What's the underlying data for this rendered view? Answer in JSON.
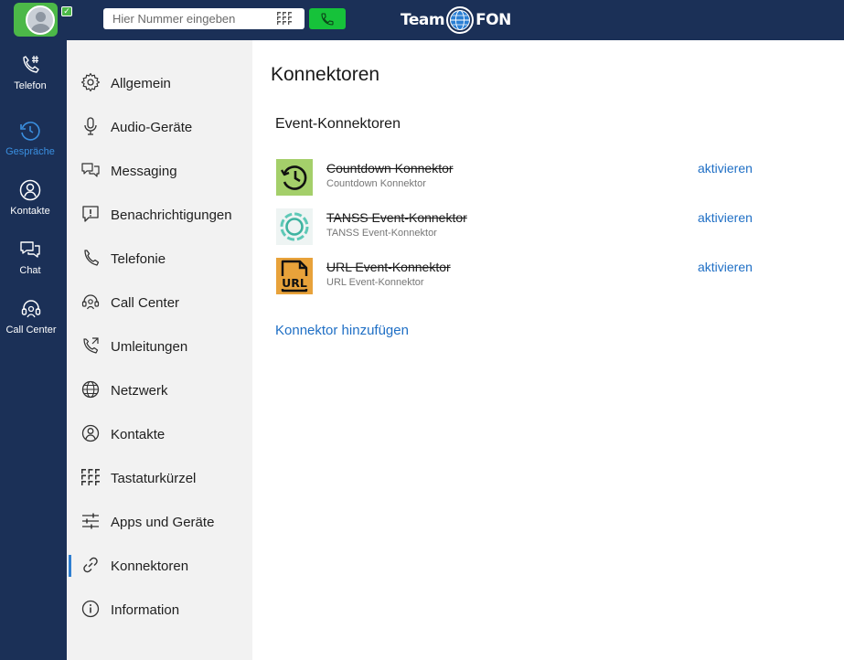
{
  "topbar": {
    "dial_placeholder": "Hier Nummer eingeben",
    "logo_left": "Team",
    "logo_right": "FON",
    "accent": "#1b3057",
    "call_color": "#16c23a"
  },
  "nav": {
    "items": [
      {
        "label": "Telefon",
        "icon": "phone-hash-icon"
      },
      {
        "label": "Gespräche",
        "icon": "history-icon",
        "active": true
      },
      {
        "label": "Kontakte",
        "icon": "contact-icon"
      },
      {
        "label": "Chat",
        "icon": "chat-icon"
      },
      {
        "label": "Call Center",
        "icon": "headset-icon"
      }
    ]
  },
  "settings": {
    "items": [
      {
        "label": "Allgemein",
        "icon": "gear-icon"
      },
      {
        "label": "Audio-Geräte",
        "icon": "microphone-icon"
      },
      {
        "label": "Messaging",
        "icon": "messaging-icon"
      },
      {
        "label": "Benachrichtigungen",
        "icon": "notification-icon"
      },
      {
        "label": "Telefonie",
        "icon": "phone-icon"
      },
      {
        "label": "Call Center",
        "icon": "headset-icon"
      },
      {
        "label": "Umleitungen",
        "icon": "forward-icon"
      },
      {
        "label": "Netzwerk",
        "icon": "globe-icon"
      },
      {
        "label": "Kontakte",
        "icon": "contact-icon"
      },
      {
        "label": "Tastaturkürzel",
        "icon": "keypad-icon"
      },
      {
        "label": "Apps und Geräte",
        "icon": "sliders-icon"
      },
      {
        "label": "Konnektoren",
        "icon": "link-icon",
        "selected": true
      },
      {
        "label": "Information",
        "icon": "info-icon"
      }
    ]
  },
  "main": {
    "title": "Konnektoren",
    "section_title": "Event-Konnektoren",
    "connectors": [
      {
        "name": "Countdown Konnektor",
        "subtitle": "Countdown Konnektor",
        "action": "aktivieren",
        "icon": "countdown-icon",
        "icon_bg": "#a4cf6a"
      },
      {
        "name": "TANSS Event-Konnektor",
        "subtitle": "TANSS Event-Konnektor",
        "action": "aktivieren",
        "icon": "tanss-icon",
        "icon_bg": "#eef4f3"
      },
      {
        "name": "URL Event-Konnektor",
        "subtitle": "URL Event-Konnektor",
        "action": "aktivieren",
        "icon": "url-icon",
        "icon_bg": "#e8a23a"
      }
    ],
    "add_link": "Konnektor hinzufügen"
  }
}
